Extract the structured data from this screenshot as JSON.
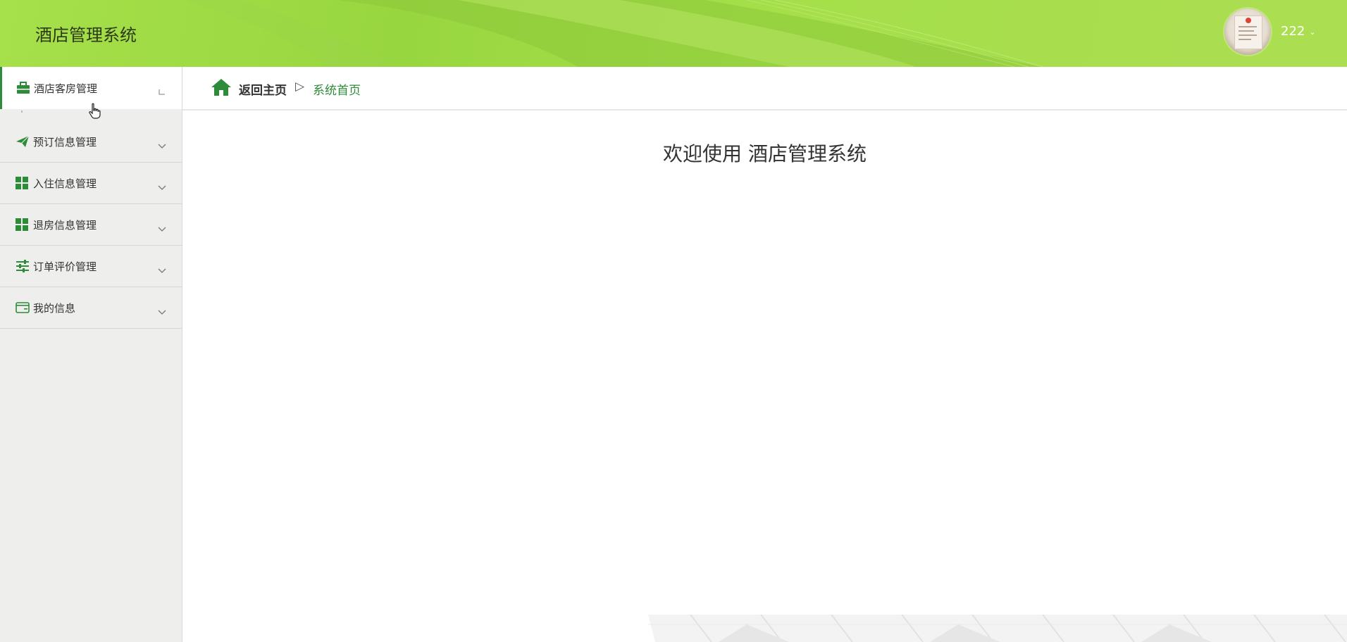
{
  "header": {
    "app_title": "酒店管理系统",
    "username": "222",
    "colors": {
      "header_bg": "#a6e04a",
      "accent": "#2e8b3a"
    }
  },
  "sidebar": {
    "items": [
      {
        "label": "酒店客房管理",
        "icon": "briefcase-icon",
        "active": true
      },
      {
        "label": "预订信息管理",
        "icon": "paper-plane-icon",
        "active": false
      },
      {
        "label": "入住信息管理",
        "icon": "grid-icon",
        "active": false
      },
      {
        "label": "退房信息管理",
        "icon": "grid-icon",
        "active": false
      },
      {
        "label": "订单评价管理",
        "icon": "sliders-icon",
        "active": false
      },
      {
        "label": "我的信息",
        "icon": "wallet-icon",
        "active": false
      }
    ]
  },
  "breadcrumb": {
    "home_label": "返回主页",
    "separator": "▷",
    "current": "系统首页"
  },
  "main": {
    "welcome": "欢迎使用 酒店管理系统"
  }
}
